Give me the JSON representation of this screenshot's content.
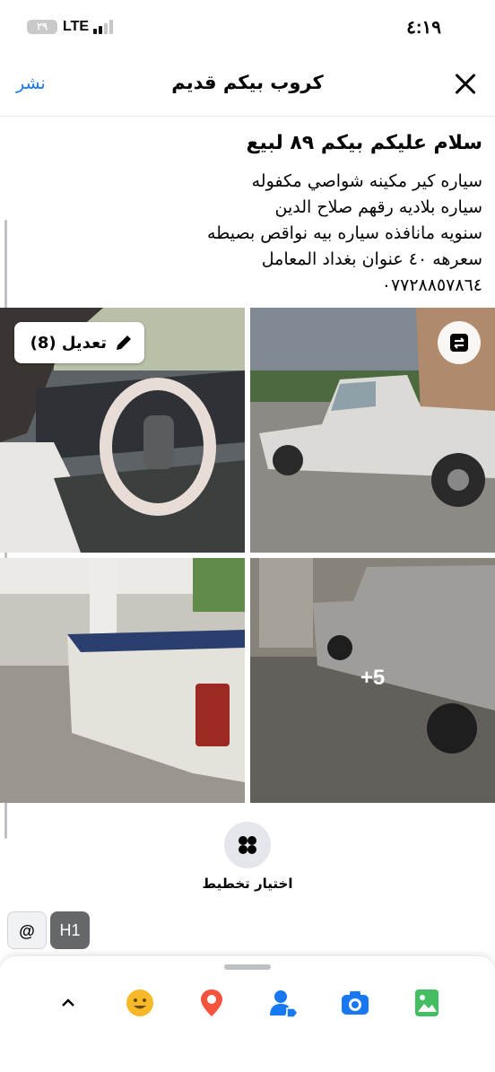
{
  "status_bar": {
    "time": "٤:١٩",
    "network": "LTE",
    "battery": "٢٩"
  },
  "header": {
    "title": "كروب بيكم قديم",
    "post_label": "نشر"
  },
  "post": {
    "headline": "سلام عليكم بيكم ٨٩ لبيع",
    "lines": [
      "سياره كير مكينه شواصي مكفوله",
      "سياره بلاديه رقهم صلاح الدين",
      "سنويه مانافذه سياره بيه نواقص بصيطه",
      "سعرهه ٤٠ عنوان بغداد المعامل",
      "٠٧٧٢٨٨٥٧٨٦٤"
    ]
  },
  "photos": {
    "edit_label": "تعديل (8)",
    "more_count": "+5"
  },
  "layout_choice_label": "اختيار تخطيط",
  "format_chips": {
    "mention": "@",
    "heading": "H1"
  },
  "toolbar": {
    "icons": [
      "chevron-up-icon",
      "emoji-icon",
      "location-icon",
      "tag-people-icon",
      "camera-icon",
      "gallery-icon"
    ]
  },
  "colors": {
    "accent": "#1877f2",
    "emoji": "#f7b928",
    "location": "#f5533d",
    "tag": "#1877f2",
    "camera": "#1877f2",
    "gallery": "#45bd62"
  }
}
